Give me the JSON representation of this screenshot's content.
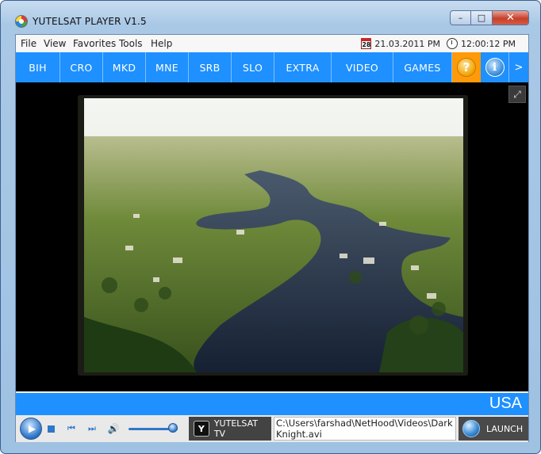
{
  "window": {
    "title": "YUTELSAT PLAYER V1.5",
    "minimize_glyph": "–",
    "maximize_glyph": "□",
    "close_glyph": "✕"
  },
  "menu": {
    "items": [
      "File",
      "View",
      "Favorites",
      "Tools",
      "Help"
    ]
  },
  "clock": {
    "calendar_day": "28",
    "date": "21.03.2011 PM",
    "time": "12:00:12 PM"
  },
  "nav": {
    "tabs": [
      "BIH",
      "CRO",
      "MKD",
      "MNE",
      "SRB",
      "SLO",
      "EXTRA",
      "VIDEO",
      "GAMES"
    ],
    "help_glyph": "?",
    "info_glyph": "i",
    "more_glyph": ">"
  },
  "colors": {
    "accent_blue": "#1e90ff",
    "help_orange": "#ff9a0a"
  },
  "video": {
    "fullscreen_icon": "expand-icon"
  },
  "region": {
    "label": "USA"
  },
  "player": {
    "play_glyph": "▶",
    "prev_glyph": "⏮",
    "next_glyph": "⏭",
    "volume_glyph": "🔊",
    "volume_level": 0.9,
    "channel_logo_text": "Y",
    "channel_label": "YUTELSAT TV",
    "file_path": "C:\\Users\\farshad\\NetHood\\Videos\\Dark Knight.avi",
    "launch_label": "LAUNCH"
  }
}
